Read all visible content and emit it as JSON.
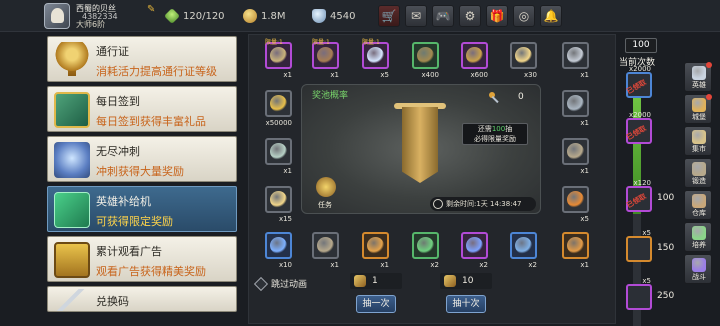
{
  "player": {
    "name": "西蜀的贝丝",
    "id": "4382334",
    "title": "大师6阶"
  },
  "resources": {
    "stamina": "120/120",
    "gold": "1.8M",
    "gems": "4540"
  },
  "top_icons": [
    "shop-icon",
    "mail-icon",
    "gamepad-icon",
    "gear-icon",
    "gift-icon",
    "wheel-icon",
    "bell-icon"
  ],
  "menu": [
    {
      "title": "通行证",
      "desc": "消耗活力提高通行证等级",
      "icon": "trophy-icon",
      "active": false
    },
    {
      "title": "每日签到",
      "desc": "每日签到获得丰富礼品",
      "icon": "book-icon",
      "active": false
    },
    {
      "title": "无尽冲刺",
      "desc": "冲刺获得大量奖励",
      "icon": "hero-emblem-icon",
      "active": false
    },
    {
      "title": "英雄补给机",
      "desc": "可获得限定奖励",
      "icon": "supply-cube-icon",
      "active": true
    },
    {
      "title": "累计观看广告",
      "desc": "观看广告获得精美奖励",
      "icon": "chest-icon",
      "active": false
    },
    {
      "title": "兑换码",
      "desc": "",
      "icon": "sword-icon",
      "active": false
    }
  ],
  "grid": [
    {
      "count": "x1",
      "tag": "限量:1",
      "quality": "purple",
      "icon": "scroll-icon"
    },
    {
      "count": "x1",
      "tag": "限量:1",
      "quality": "purple",
      "icon": "mystery-pouch-icon"
    },
    {
      "count": "x5",
      "tag": "限量:1",
      "quality": "purple",
      "icon": "star-gem-icon"
    },
    {
      "count": "x400",
      "tag": "",
      "quality": "green",
      "icon": "scroll-green-icon"
    },
    {
      "count": "x600",
      "tag": "",
      "quality": "purple",
      "icon": "ticket-icon"
    },
    {
      "count": "x30",
      "tag": "",
      "quality": "gray",
      "icon": "egg-icon"
    },
    {
      "count": "x1",
      "tag": "",
      "quality": "gray",
      "icon": "dagger-icon"
    },
    {
      "count": "x50000",
      "tag": "",
      "quality": "gray",
      "icon": "coin-icon"
    },
    {
      "count": "x1",
      "tag": "",
      "quality": "gray",
      "icon": "map-icon"
    },
    {
      "count": "x15",
      "tag": "",
      "quality": "gray",
      "icon": "egg-icon"
    },
    {
      "count": "x1",
      "tag": "",
      "quality": "gray",
      "icon": "ring-icon"
    },
    {
      "count": "x1",
      "tag": "",
      "quality": "gray",
      "icon": "hammer-icon"
    },
    {
      "count": "x5",
      "tag": "",
      "quality": "gray",
      "icon": "fire-icon"
    },
    {
      "count": "x10",
      "tag": "",
      "quality": "blue",
      "icon": "blue-rune-icon"
    },
    {
      "count": "x1",
      "tag": "",
      "quality": "gray",
      "icon": "hammer-icon"
    },
    {
      "count": "x1",
      "tag": "",
      "quality": "orange",
      "icon": "medal-icon"
    },
    {
      "count": "x2",
      "tag": "",
      "quality": "green",
      "icon": "green-gem-icon"
    },
    {
      "count": "x2",
      "tag": "",
      "quality": "purple",
      "icon": "blue-book-icon"
    },
    {
      "count": "x2",
      "tag": "",
      "quality": "blue",
      "icon": "blue-card-icon"
    },
    {
      "count": "x1",
      "tag": "",
      "quality": "orange",
      "icon": "orange-book-icon"
    }
  ],
  "pool": {
    "title": "奖池概率",
    "key_count": "0",
    "tip_prefix": "还需",
    "tip_num": "100",
    "tip_suffix": "抽",
    "tip_line2": "必得限量奖励",
    "hero_label": "任务",
    "timer": "剩余时间:1天 14:38:47"
  },
  "controls": {
    "skip": "跳过动画",
    "cost_one": "1",
    "cost_ten": "10",
    "draw_one": "抽一次",
    "draw_ten": "抽十次"
  },
  "progress": {
    "current": "100",
    "label": "当前次数",
    "claimed": "已领取",
    "milestones": [
      {
        "need": "",
        "count": "x2000",
        "claimed": true
      },
      {
        "need": "",
        "count": "x2000",
        "claimed": true
      },
      {
        "need": "100",
        "count": "x120",
        "claimed": true
      },
      {
        "need": "150",
        "count": "x5",
        "claimed": false
      },
      {
        "need": "250",
        "count": "x5",
        "claimed": false
      }
    ],
    "fill": 0.56
  },
  "sidenav": [
    {
      "label": "英雄",
      "icon": "hero-nav-icon",
      "badge": true
    },
    {
      "label": "城堡",
      "icon": "castle-icon",
      "badge": true
    },
    {
      "label": "集市",
      "icon": "market-icon",
      "badge": false
    },
    {
      "label": "锻造",
      "icon": "anvil-icon",
      "badge": false
    },
    {
      "label": "仓库",
      "icon": "warehouse-icon",
      "badge": false
    },
    {
      "label": "培养",
      "icon": "potion-icon",
      "badge": false
    },
    {
      "label": "战斗",
      "icon": "battle-icon",
      "badge": false
    }
  ]
}
